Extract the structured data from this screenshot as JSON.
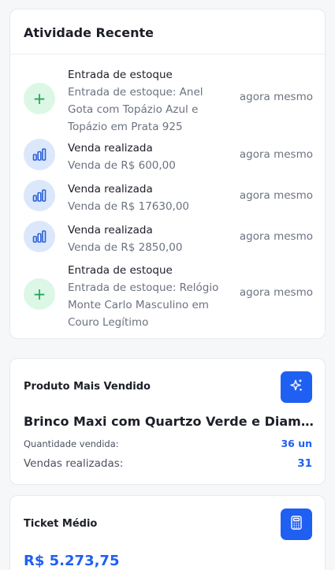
{
  "activity": {
    "title": "Atividade Recente",
    "items": [
      {
        "type": "stock-entry",
        "icon": "plus-icon",
        "title": "Entrada de estoque",
        "desc_lines": [
          "Entrada de estoque: Anel",
          "Gota com Topázio Azul e",
          "Topázio em Prata 925"
        ],
        "time": "agora mesmo"
      },
      {
        "type": "sale",
        "icon": "bar-chart-icon",
        "title": "Venda realizada",
        "desc_lines": [
          "Venda de R$ 600,00"
        ],
        "time": "agora mesmo"
      },
      {
        "type": "sale",
        "icon": "bar-chart-icon",
        "title": "Venda realizada",
        "desc_lines": [
          "Venda de R$ 17630,00"
        ],
        "time": "agora mesmo"
      },
      {
        "type": "sale",
        "icon": "bar-chart-icon",
        "title": "Venda realizada",
        "desc_lines": [
          "Venda de R$ 2850,00"
        ],
        "time": "agora mesmo"
      },
      {
        "type": "stock-entry",
        "icon": "plus-icon",
        "title": "Entrada de estoque",
        "desc_lines": [
          "Entrada de estoque: Relógio",
          "Monte Carlo Masculino em",
          "Couro Legítimo"
        ],
        "time": "agora mesmo"
      }
    ]
  },
  "top_product": {
    "label": "Produto Mais Vendido",
    "icon": "sparkles-icon",
    "name": "Brinco Maxi com Quartzo Verde e Diamantes",
    "qty_label": "Quantidade vendida:",
    "qty_value": "36 un",
    "sales_label": "Vendas realizadas:",
    "sales_value": "31"
  },
  "ticket": {
    "label": "Ticket Médio",
    "icon": "calculator-icon",
    "value": "R$ 5.273,75"
  },
  "colors": {
    "accent": "#1f5ff2",
    "green_bg": "#dcf7e6",
    "green_fg": "#1ea34f",
    "blue_bg": "#dbe8fb",
    "blue_fg": "#2a60d6"
  }
}
